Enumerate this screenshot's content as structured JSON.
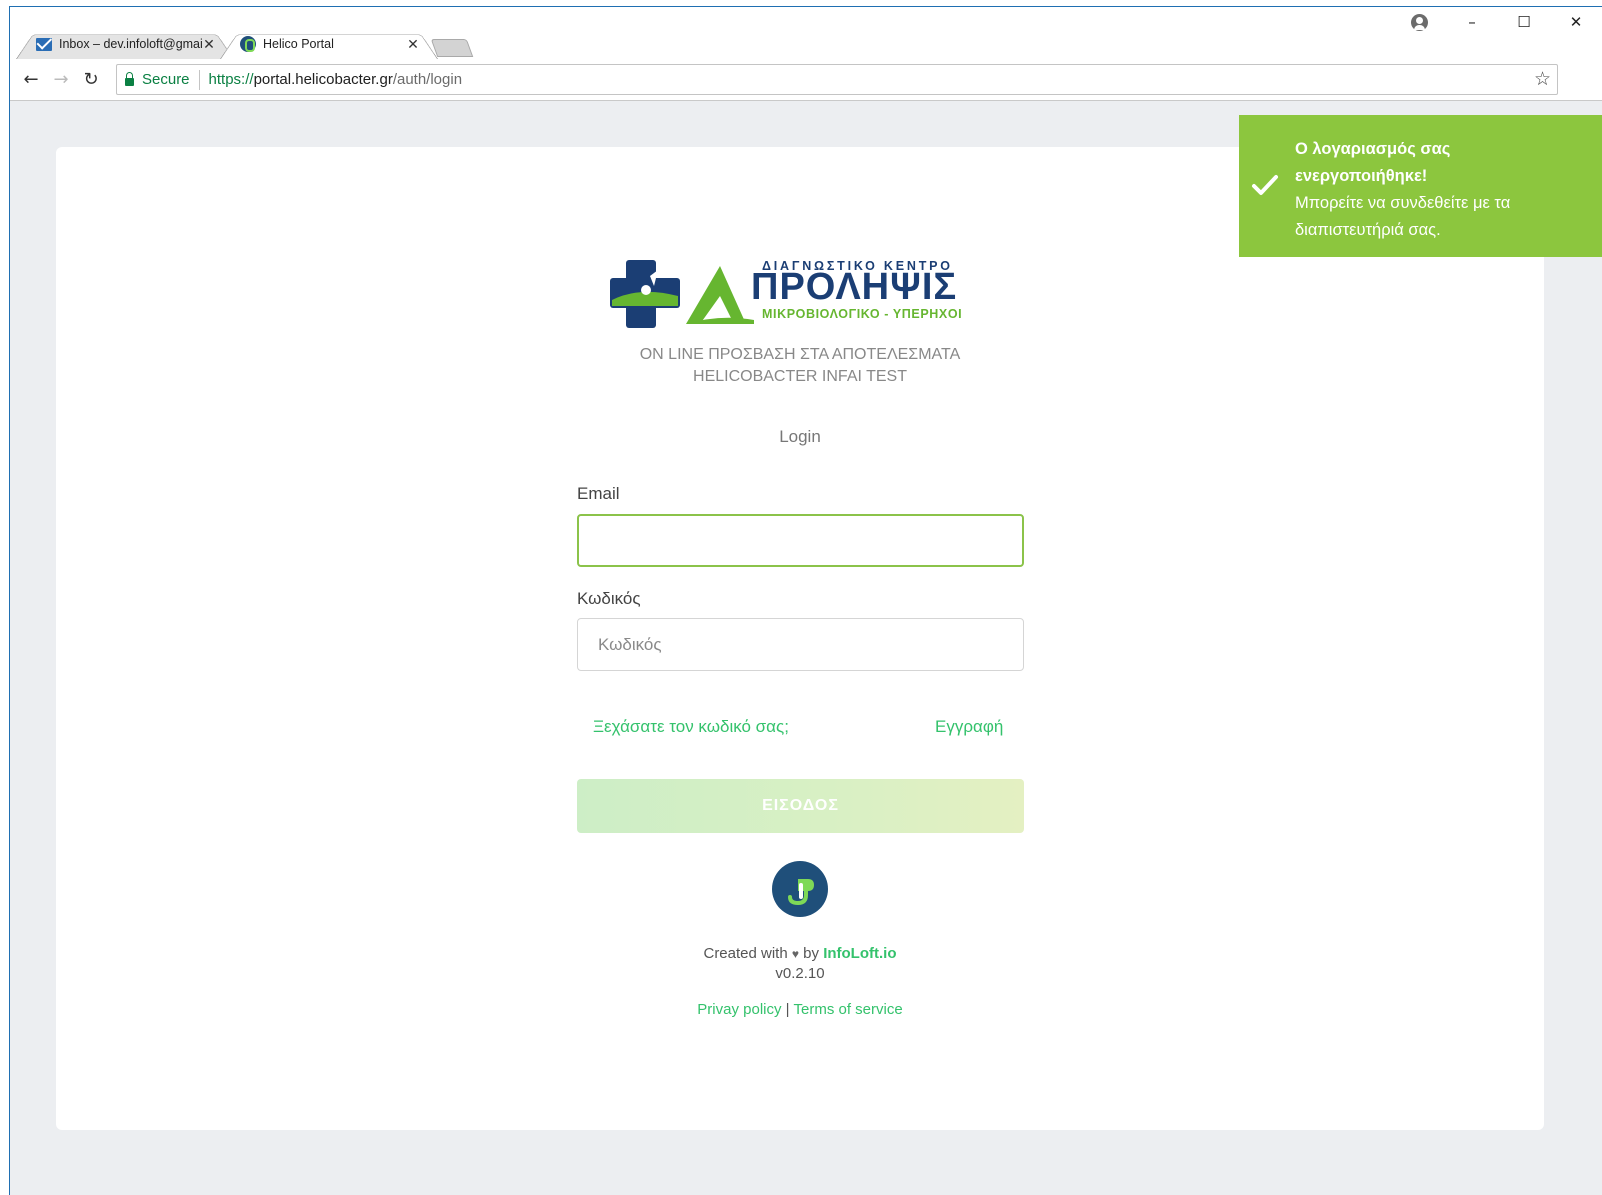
{
  "browser": {
    "tabs": [
      {
        "title": "Inbox – dev.infoloft@gmail.com",
        "icon": "mail-icon",
        "active": false
      },
      {
        "title": "Helico Portal",
        "icon": "helico-favicon",
        "active": true
      }
    ],
    "address": {
      "secure_label": "Secure",
      "scheme": "https://",
      "host": "portal.helicobacter.gr",
      "path": "/auth/login"
    }
  },
  "logo": {
    "top_text": "ΔΙΑΓΝΩΣΤΙΚΟ ΚΕΝΤΡΟ",
    "main_text": "ΠΡΟΛΗΨΙΣ",
    "sub_text": "ΜΙΚΡΟΒΙΟΛΟΓΙΚΟ - ΥΠΕΡΗΧΟΙ",
    "brand_letter": "Δ"
  },
  "page": {
    "subtitle_line1": "ON LINE ΠΡΟΣΒΑΣΗ ΣΤΑ ΑΠΟΤΕΛΕΣΜΑΤΑ",
    "subtitle_line2": "HELICOBACTER INFAI TEST",
    "login_title": "Login"
  },
  "form": {
    "email_label": "Email",
    "email_value": "",
    "password_label": "Κωδικός",
    "password_placeholder": "Κωδικός",
    "forgot_link": "Ξεχάσατε τον κωδικό σας;",
    "register_link": "Εγγραφή",
    "submit_label": "ΕΙΣΟΔΟΣ"
  },
  "footer": {
    "created_prefix": "Created with",
    "created_by": "by",
    "brand": "InfoLoft.io",
    "version": "v0.2.10",
    "privacy": "Privay policy",
    "separator": "|",
    "terms": "Terms of service"
  },
  "toast": {
    "title": "Ο λογαριασμός σας ενεργοποιήθηκε!",
    "message": "Μπορείτε να συνδεθείτε με τα διαπιστευτήριά σας.",
    "color": "#8cc63e"
  },
  "colors": {
    "accent": "#34c26c",
    "brand_blue": "#1b3e74",
    "brand_green": "#66b630"
  }
}
